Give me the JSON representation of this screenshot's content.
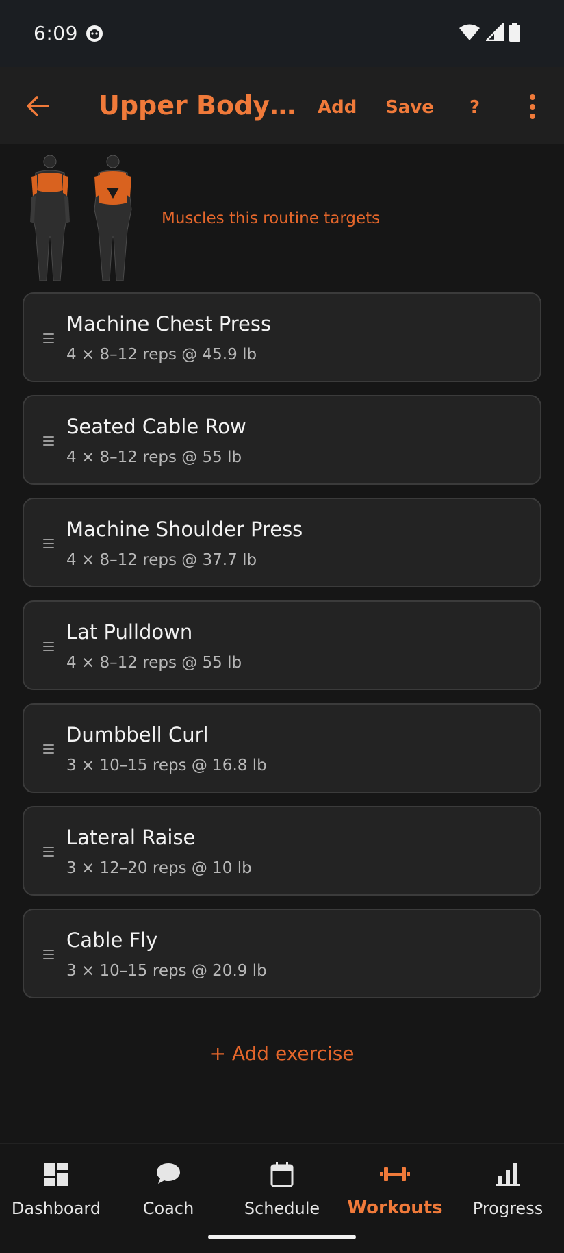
{
  "status_bar": {
    "time": "6:09"
  },
  "app_bar": {
    "title": "Upper Body A...",
    "add_label": "Add",
    "save_label": "Save",
    "help_label": "?"
  },
  "muscles": {
    "caption": "Muscles this routine targets"
  },
  "exercises": [
    {
      "name": "Machine Chest Press",
      "detail": "4 × 8–12 reps @ 45.9 lb"
    },
    {
      "name": "Seated Cable Row",
      "detail": "4 × 8–12 reps @ 55 lb"
    },
    {
      "name": "Machine Shoulder Press",
      "detail": "4 × 8–12 reps @ 37.7 lb"
    },
    {
      "name": "Lat Pulldown",
      "detail": "4 × 8–12 reps @ 55 lb"
    },
    {
      "name": "Dumbbell Curl",
      "detail": "3 × 10–15 reps @ 16.8 lb"
    },
    {
      "name": "Lateral Raise",
      "detail": "3 × 12–20 reps @ 10 lb"
    },
    {
      "name": "Cable Fly",
      "detail": "3 × 10–15 reps @ 20.9 lb"
    }
  ],
  "add_exercise_label": "+ Add exercise",
  "nav": {
    "items": [
      {
        "label": "Dashboard",
        "icon": "dashboard-icon"
      },
      {
        "label": "Coach",
        "icon": "chat-bubble-icon"
      },
      {
        "label": "Schedule",
        "icon": "calendar-icon"
      },
      {
        "label": "Workouts",
        "icon": "dumbbell-icon",
        "active": true
      },
      {
        "label": "Progress",
        "icon": "bar-chart-icon"
      }
    ]
  },
  "colors": {
    "accent": "#f07a3a",
    "background": "#161616",
    "card": "#232323",
    "card_border": "#3b3b3b"
  }
}
